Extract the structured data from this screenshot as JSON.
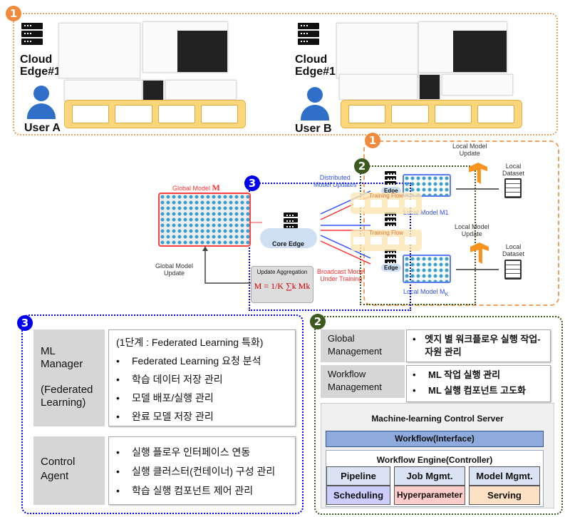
{
  "top": {
    "badge": "1",
    "left": {
      "server_label": "Cloud\nEdge#1",
      "user_label": "User A"
    },
    "right": {
      "server_label": "Cloud\nEdge#1",
      "user_label": "User B"
    }
  },
  "middle": {
    "badge_orange": "1",
    "badge_green": "2",
    "badge_blue": "3",
    "global_model_label": "Global Model ",
    "global_model_symbol": "M",
    "core_edge": "Core Edge",
    "update_aggregation": "Update Aggregation",
    "formula": "M = 1/K ∑k Mk",
    "global_model_update": "Global Model\nUpdate",
    "distributed_updates": "Distributed\nModel Updates",
    "broadcast": "Broadcast Model\nUnder Training",
    "edge_labels": [
      "Edoe",
      "Edge"
    ],
    "training_flow": "Training Flow",
    "local_model_update": "Local Model\nUpdate",
    "local_dataset": "Local\nDataset",
    "local_model_k": "Local Model M",
    "local_model_k_sub": "K",
    "local_model_1": "Local Model M1"
  },
  "left_panel": {
    "badge": "3",
    "ml_manager": {
      "title": "ML\nManager\n\n(Federated\nLearning)",
      "heading": "(1단계 : Federated Learning 특화)",
      "items": [
        "Federated Learning 요청 분석",
        "학습 데이터 저장 관리",
        "모델 배포/실행 관리",
        "완료 모델 저장 관리"
      ]
    },
    "control_agent": {
      "title": "Control\nAgent",
      "items": [
        "실행 플로우 인터페이스 연동",
        "실행 클러스터(컨테이너) 구성 관리",
        "학습 실행 컴포넌트 제어 관리"
      ]
    }
  },
  "right_panel": {
    "badge": "2",
    "global_management": {
      "title": "Global\nManagement",
      "items": [
        "엣지 별 워크플로우 실행 작업-자원 관리"
      ]
    },
    "workflow_management": {
      "title": "Workflow\nManagement",
      "items": [
        "ML 작업 실행 관리",
        "ML 실행 컴포넌트 고도화"
      ]
    },
    "server": {
      "title": "Machine-learning Control Server",
      "interface": "Workflow(Interface)",
      "engine": "Workflow Engine(Controller)",
      "cells": [
        {
          "label": "Pipeline",
          "color": "#dae3f3"
        },
        {
          "label": "Job Mgmt.",
          "color": "#dae3f3"
        },
        {
          "label": "Model Mgmt.",
          "color": "#dae3f3"
        },
        {
          "label": "Scheduling",
          "color": "#ccccff"
        },
        {
          "label": "Hyperparameter",
          "color": "#ffcccc"
        },
        {
          "label": "Serving",
          "color": "#fde1c4"
        }
      ]
    }
  },
  "colors": {
    "orange": "#f08a3c",
    "green": "#3a5a1e",
    "blue": "#0000ee",
    "red": "#ff3030"
  }
}
